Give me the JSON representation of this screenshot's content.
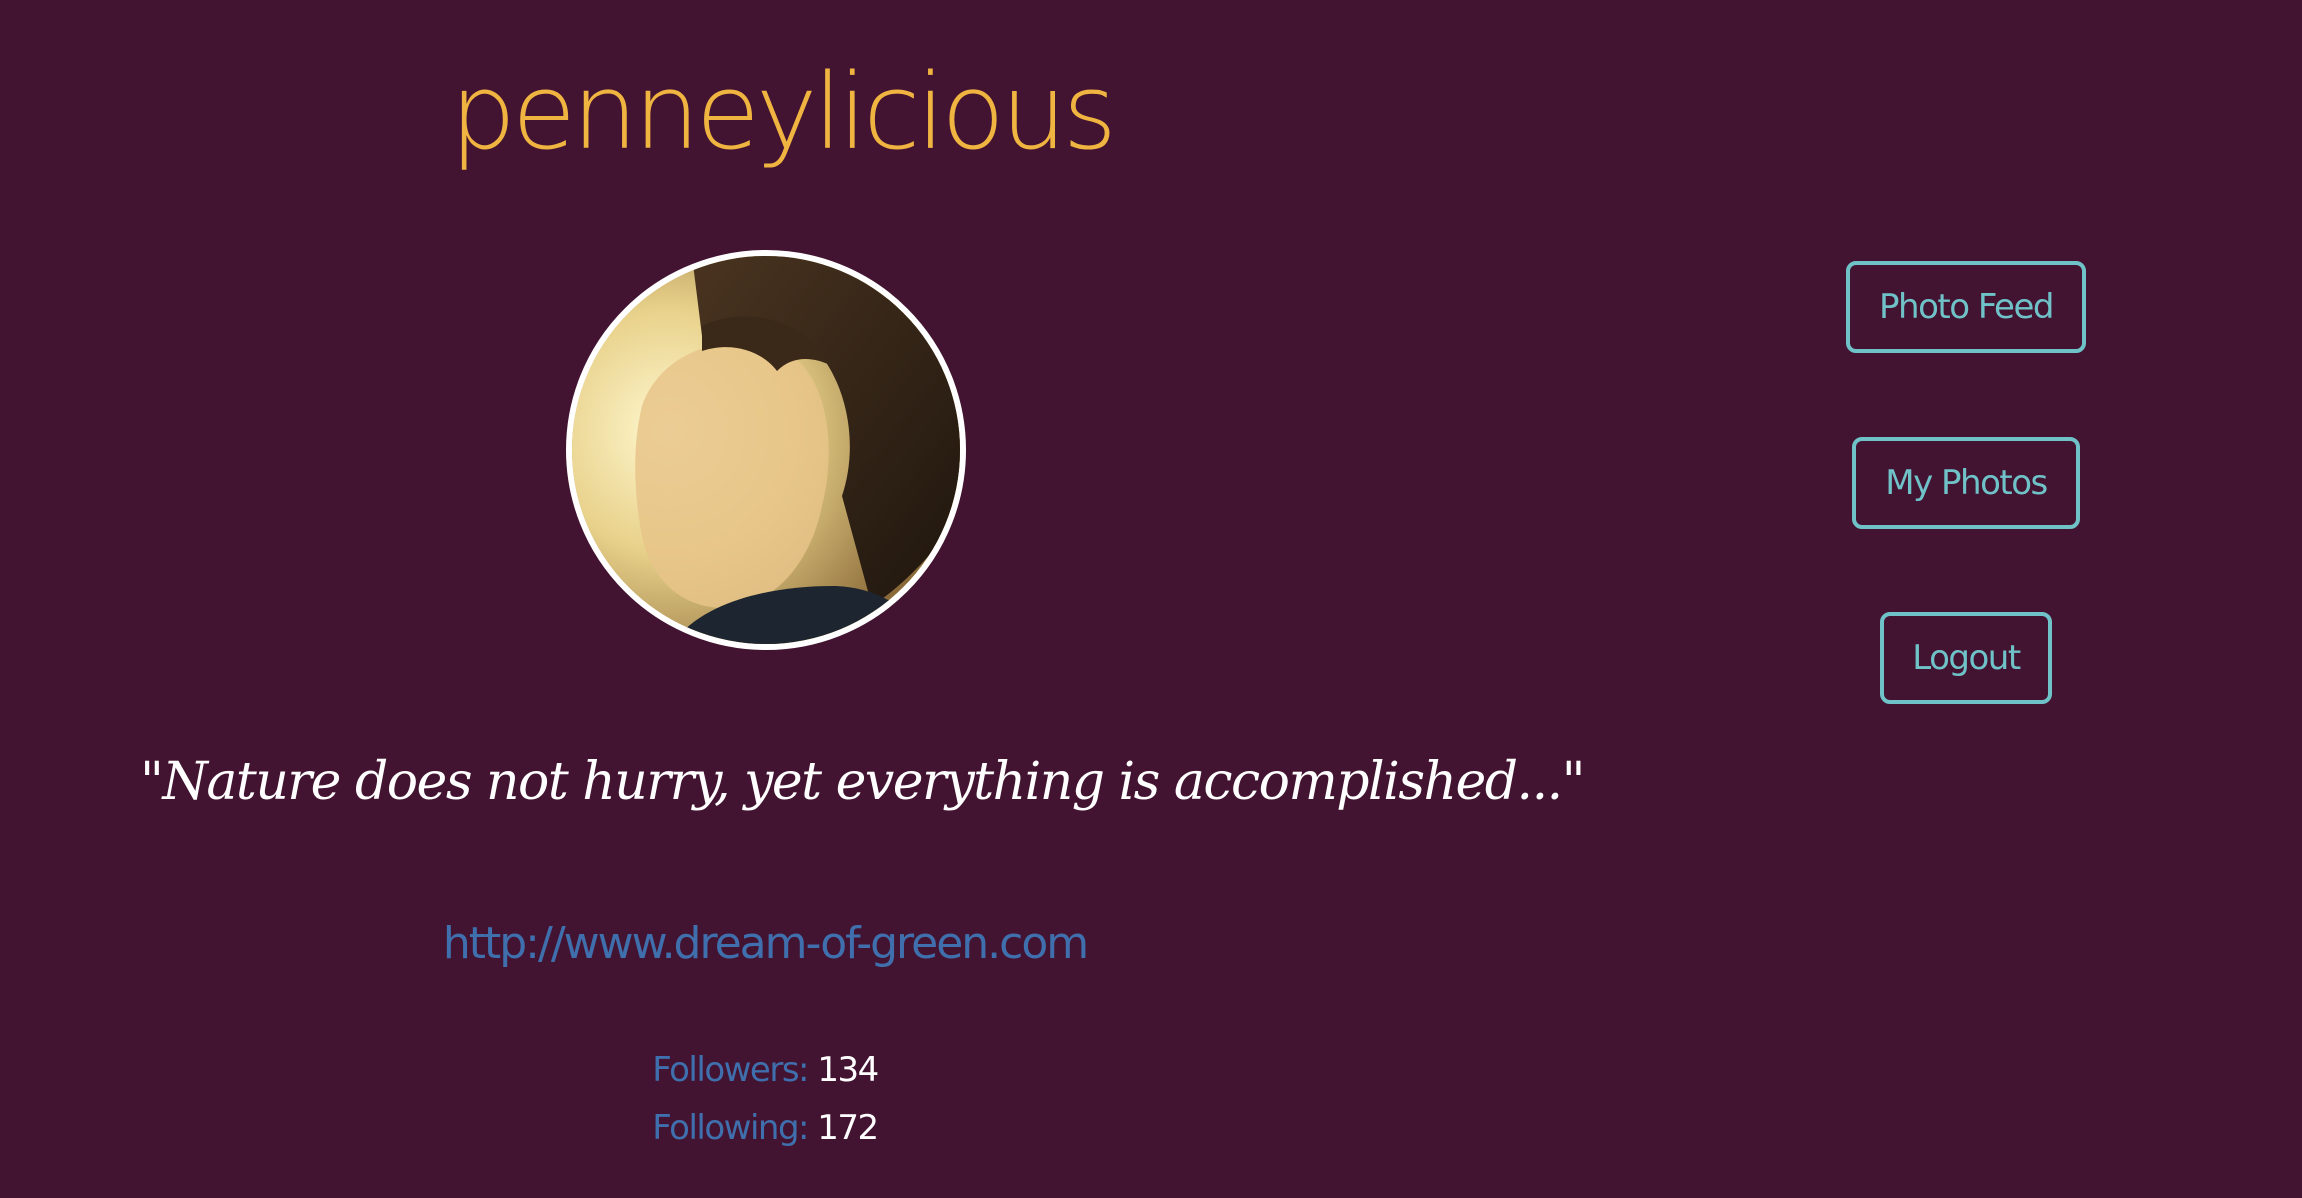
{
  "profile": {
    "username": "penneylicious",
    "quote": "\"Nature does not hurry, yet everything is accomplished...\"",
    "website": "http://www.dream-of-green.com",
    "followers_label": "Followers:",
    "followers_count": "134",
    "following_label": "Following:",
    "following_count": "172"
  },
  "nav": {
    "photo_feed": "Photo Feed",
    "my_photos": "My Photos",
    "logout": "Logout"
  },
  "colors": {
    "background": "#431431",
    "username": "#f0b441",
    "link": "#3f6fad",
    "button": "#6fc3c8",
    "text": "#ffffff"
  }
}
